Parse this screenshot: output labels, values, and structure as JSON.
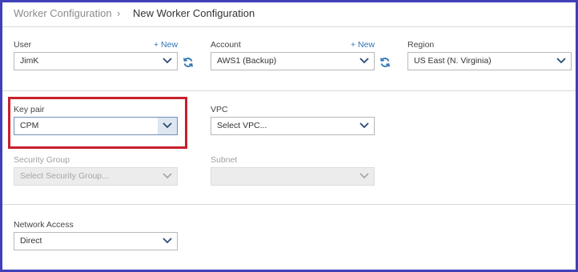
{
  "breadcrumb": {
    "parent": "Worker Configuration",
    "separator": "›",
    "current": "New Worker Configuration"
  },
  "fields": {
    "user": {
      "label": "User",
      "new_link": "+ New",
      "value": "JimK"
    },
    "account": {
      "label": "Account",
      "new_link": "+ New",
      "value": "AWS1 (Backup)"
    },
    "region": {
      "label": "Region",
      "value": "US East (N. Virginia)"
    },
    "key_pair": {
      "label": "Key pair",
      "value": "CPM"
    },
    "vpc": {
      "label": "VPC",
      "value": "Select VPC..."
    },
    "security_group": {
      "label": "Security Group",
      "value": "Select Security Group..."
    },
    "subnet": {
      "label": "Subnet",
      "value": ""
    },
    "network_access": {
      "label": "Network Access",
      "value": "Direct"
    }
  },
  "icons": {
    "refresh": "refresh-icon",
    "chevron": "chevron-down-icon"
  },
  "colors": {
    "frame_border": "#3f3fb8",
    "highlight": "#c8202c",
    "link": "#2f75b5",
    "refresh_icon": "#2f75b5",
    "disabled_bg": "#ececec"
  }
}
